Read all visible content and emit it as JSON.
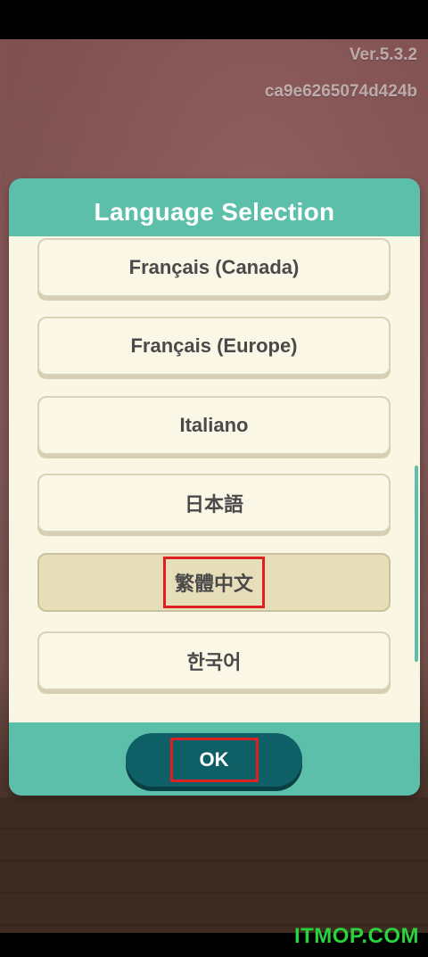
{
  "app": {
    "version": "Ver.5.3.2",
    "hash": "ca9e6265074d424b"
  },
  "dialog": {
    "title": "Language Selection",
    "languages": [
      {
        "label": "Français (Canada)",
        "selected": false
      },
      {
        "label": "Français (Europe)",
        "selected": false
      },
      {
        "label": "Italiano",
        "selected": false
      },
      {
        "label": "日本語",
        "selected": false
      },
      {
        "label": "繁體中文",
        "selected": true
      },
      {
        "label": "한국어",
        "selected": false
      }
    ],
    "ok_label": "OK"
  },
  "watermark": "ITMOP.COM",
  "colors": {
    "dialog_accent": "#5bbfaa",
    "ok_button": "#0f5f66",
    "highlight_box": "#e02020",
    "list_background": "#faf6e4"
  }
}
